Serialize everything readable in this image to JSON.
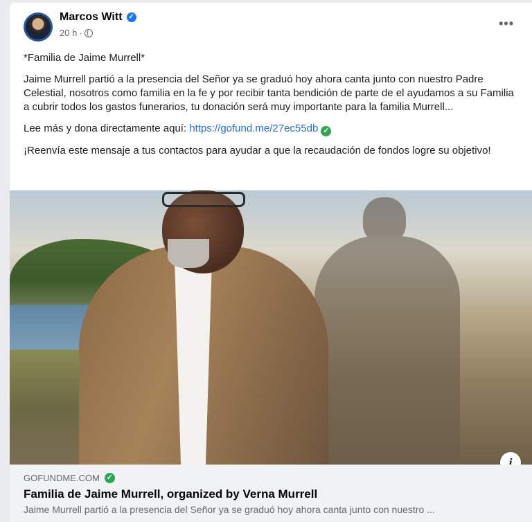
{
  "post": {
    "author": "Marcos Witt",
    "time": "20 h",
    "time_separator": "·",
    "more_label": "•••",
    "title_line": "*Familia de Jaime Murrell*",
    "paragraph": "Jaime Murrell partió a la presencia del Señor ya se graduó hoy ahora canta junto con nuestro Padre Celestial, nosotros como familia en la fe y por recibir tanta bendición de parte de el ayudamos a su Familia a cubrir todos los gastos funerarios, tu donación será muy importante para la familia Murrell...",
    "cta_prefix": "Lee más y dona directamente aquí: ",
    "cta_link": "https://gofund.me/27ec55db",
    "forward_text": "¡Reenvía este mensaje a tus contactos para ayudar a que la recaudación de fondos logre su objetivo!",
    "verified_icon": "verified-badge-icon",
    "check_icon": "green-check-icon"
  },
  "photo": {
    "info_label": "i"
  },
  "link_card": {
    "domain": "GOFUNDME.COM",
    "title": "Familia de Jaime Murrell, organized by Verna Murrell",
    "description": "Jaime Murrell partió a la presencia del Señor ya se graduó hoy ahora canta junto con nuestro ..."
  },
  "colors": {
    "link": "#216fdb",
    "verified": "#1877f2",
    "check": "#2ea54e",
    "card_bg": "#f0f2f5"
  }
}
